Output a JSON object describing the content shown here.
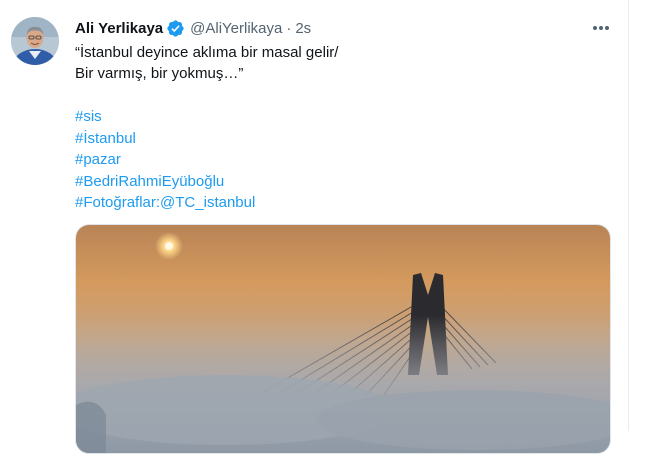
{
  "tweet": {
    "author_name": "Ali Yerlikaya",
    "handle": "@AliYerlikaya",
    "separator": "·",
    "time": "2s",
    "text_lines": [
      "“İstanbul deyince aklıma bir masal gelir/",
      "Bir varmış, bir yokmuş…”"
    ],
    "hashtags": [
      "#sis",
      "#İstanbul",
      "#pazar",
      "#BedriRahmiEyüboğlu",
      "#Fotoğraflar:@TC_istanbul"
    ],
    "more_icon": "more-horizontal-icon",
    "verified_icon": "verified-badge-icon"
  },
  "colors": {
    "link": "#1d9bf0",
    "verified": "#1d9bf0",
    "secondary_text": "#536471",
    "primary_text": "#0f1419"
  }
}
